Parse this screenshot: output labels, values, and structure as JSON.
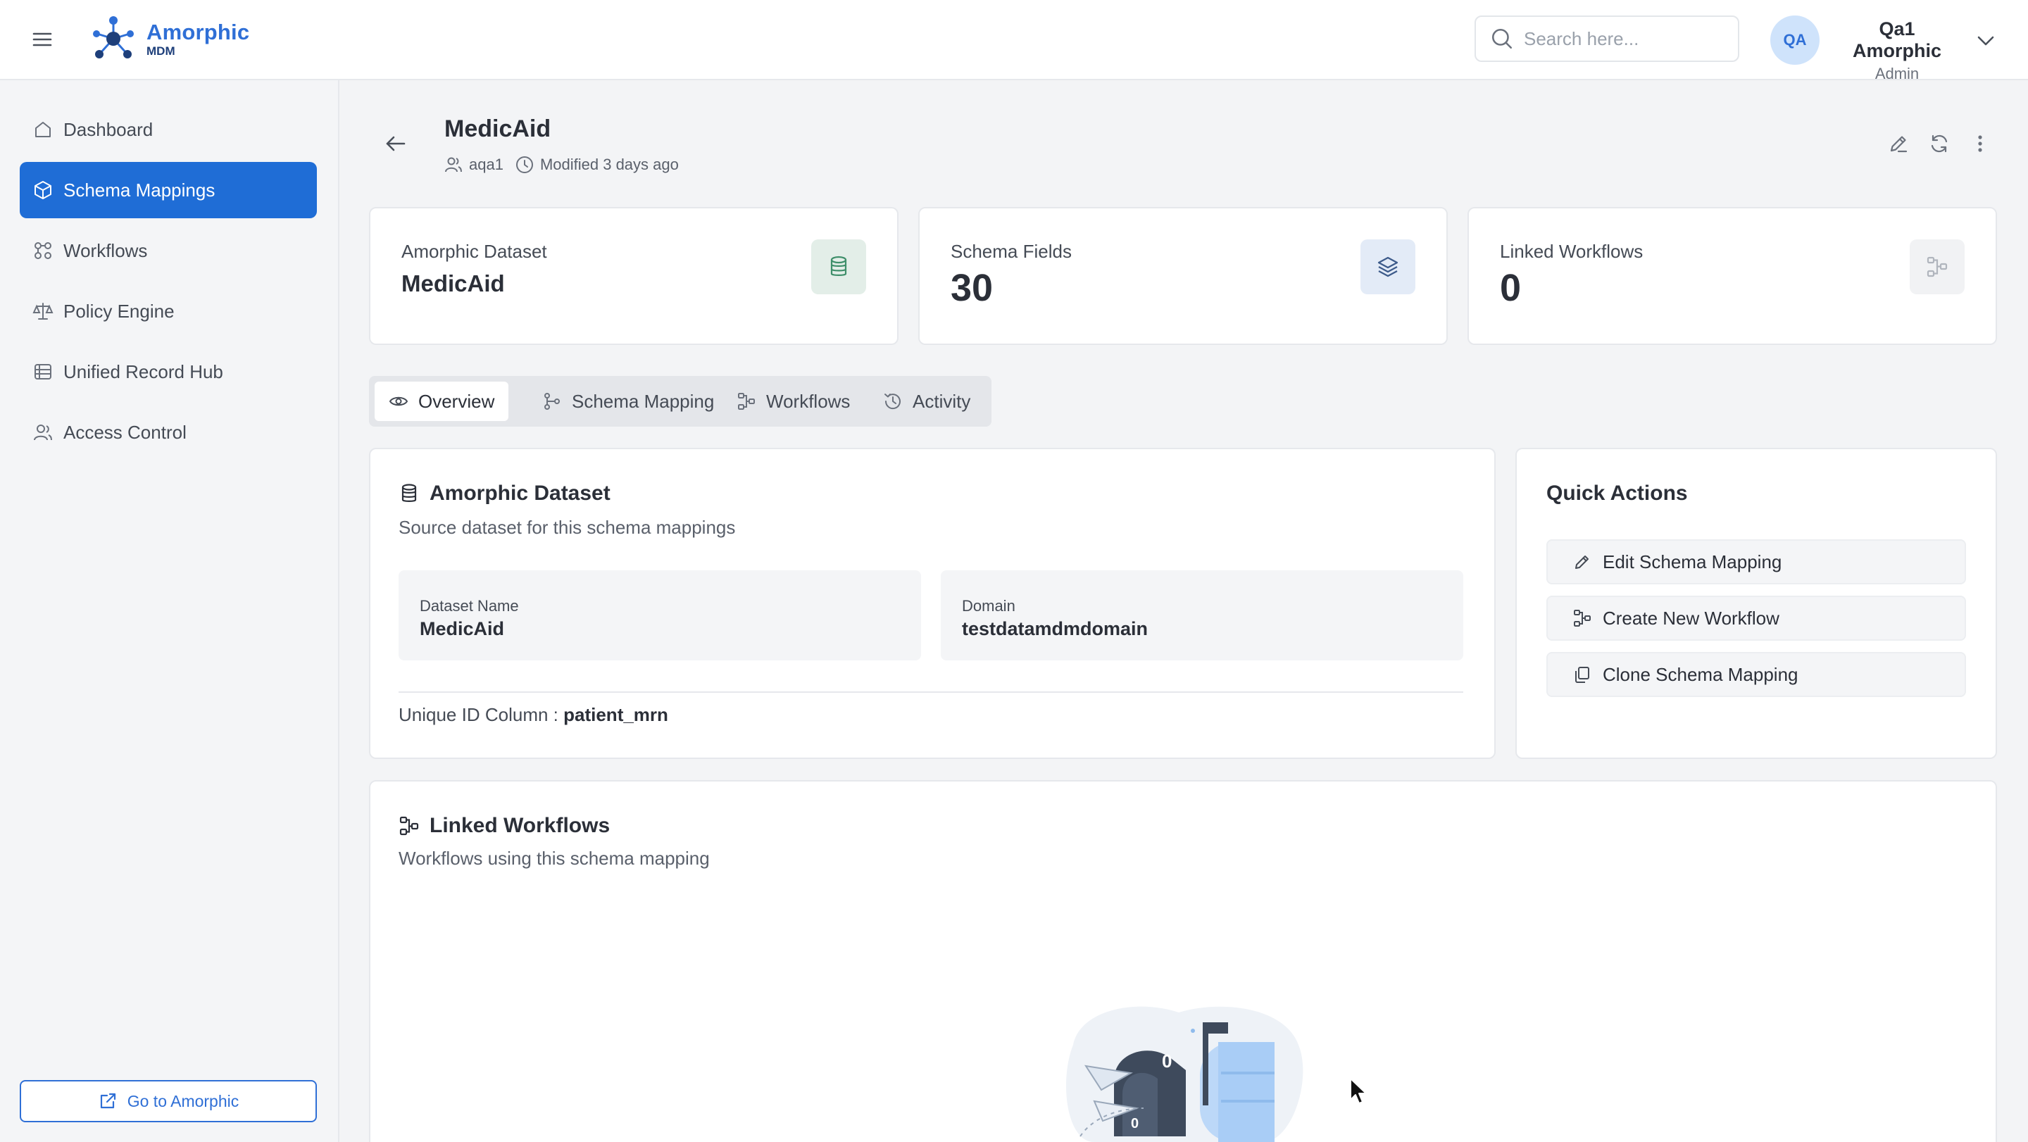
{
  "brand": {
    "name": "Amorphic",
    "sub": "MDM"
  },
  "search": {
    "placeholder": "Search here..."
  },
  "user": {
    "initials": "QA",
    "name": "Qa1 Amorphic",
    "role": "Admin"
  },
  "sidebar": {
    "items": [
      {
        "label": "Dashboard",
        "icon": "home-icon"
      },
      {
        "label": "Schema Mappings",
        "icon": "cube-icon",
        "active": true
      },
      {
        "label": "Workflows",
        "icon": "workflow-icon"
      },
      {
        "label": "Policy Engine",
        "icon": "scale-icon"
      },
      {
        "label": "Unified Record Hub",
        "icon": "records-icon"
      },
      {
        "label": "Access Control",
        "icon": "users-icon"
      }
    ],
    "go_button": "Go to Amorphic"
  },
  "page": {
    "title": "MedicAid",
    "owner": "aqa1",
    "modified": "Modified 3 days ago"
  },
  "stats": [
    {
      "label": "Amorphic Dataset",
      "value": "MedicAid",
      "icon": "database-icon",
      "icon_bg": "#e3eee8",
      "icon_color": "#3f8f6a"
    },
    {
      "label": "Schema Fields",
      "value": "30",
      "icon": "layers-icon",
      "icon_bg": "#e3ebf7",
      "icon_color": "#3c5a8a"
    },
    {
      "label": "Linked Workflows",
      "value": "0",
      "icon": "workflow-icon",
      "icon_bg": "#f1f2f4",
      "icon_color": "#b0b5bd"
    }
  ],
  "tabs": [
    {
      "label": "Overview",
      "icon": "eye-icon",
      "active": true
    },
    {
      "label": "Schema Mapping",
      "icon": "git-branch-icon"
    },
    {
      "label": "Workflows",
      "icon": "workflow-icon"
    },
    {
      "label": "Activity",
      "icon": "history-icon"
    }
  ],
  "dataset_panel": {
    "title": "Amorphic Dataset",
    "subtitle": "Source dataset for this schema mappings",
    "dataset_name_label": "Dataset Name",
    "dataset_name": "MedicAid",
    "domain_label": "Domain",
    "domain": "testdatamdmdomain",
    "uid_label": "Unique ID Column :",
    "uid_value": "patient_mrn"
  },
  "quick_actions": {
    "title": "Quick Actions",
    "items": [
      {
        "label": "Edit Schema Mapping",
        "icon": "pencil-icon"
      },
      {
        "label": "Create New Workflow",
        "icon": "workflow-icon"
      },
      {
        "label": "Clone Schema Mapping",
        "icon": "copy-icon"
      }
    ]
  },
  "linked_workflows": {
    "title": "Linked Workflows",
    "subtitle": "Workflows using this schema mapping",
    "mailbox_count_top": "0",
    "mailbox_count_bottom": "0"
  },
  "colors": {
    "accent": "#1f6dd6",
    "brand_blue": "#2f6fd6",
    "background": "#f3f4f6"
  }
}
